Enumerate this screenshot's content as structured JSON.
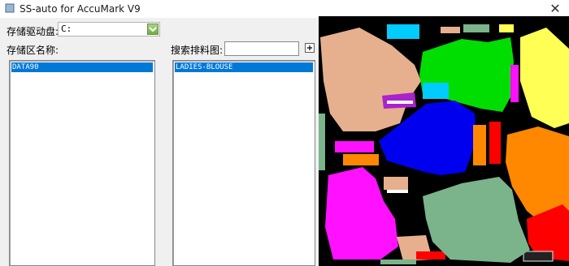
{
  "window": {
    "title": "SS-auto for AccuMark V9",
    "close_glyph": "✕"
  },
  "drive": {
    "label": "存储驱动盘:",
    "value": "C:"
  },
  "storage_area": {
    "label": "存储区名称:",
    "items": [
      "DATA90"
    ]
  },
  "search_marker": {
    "label": "搜索排料图:",
    "value": "",
    "add_glyph": "+"
  },
  "marker_list": {
    "items": [
      "LADIES-BLOUSE"
    ]
  },
  "preview": {
    "background": "#000000",
    "piece_colors": [
      "#e6b08e",
      "#00dd00",
      "#ffff55",
      "#0000ee",
      "#ff11ff",
      "#7bb38b",
      "#ff8800",
      "#ff0000",
      "#00ccff",
      "#aa22cc",
      "#ffffff"
    ]
  },
  "colors": {
    "selection": "#0078d7",
    "client_bg": "#f0f0f0",
    "combo_arrow": "#8bc34a"
  }
}
